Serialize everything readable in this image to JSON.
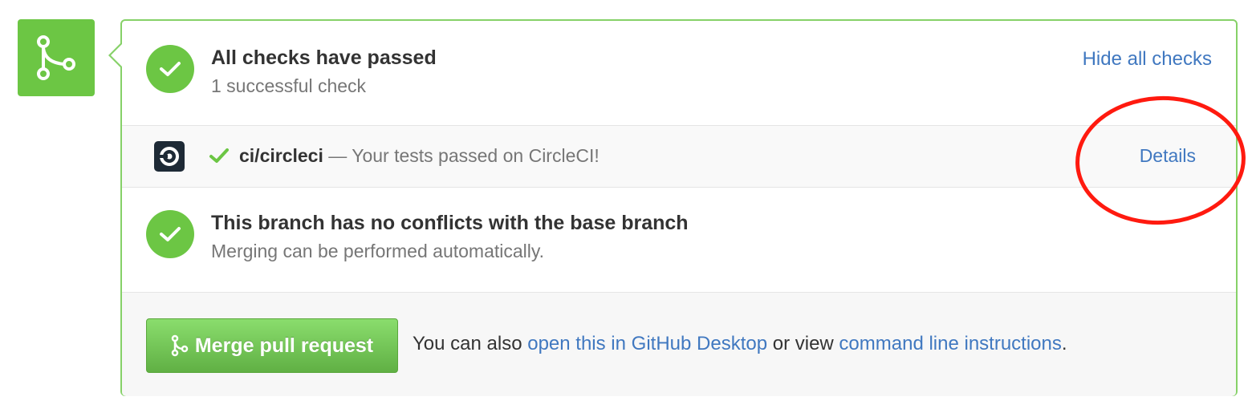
{
  "checks": {
    "title": "All checks have passed",
    "subtitle": "1 successful check",
    "toggle_label": "Hide all checks"
  },
  "ci": {
    "icon": "circleci-logo",
    "name": "ci/circleci",
    "separator": " — ",
    "description": "Your tests passed on CircleCI!",
    "details_label": "Details"
  },
  "branch": {
    "title": "This branch has no conflicts with the base branch",
    "subtitle": "Merging can be performed automatically."
  },
  "merge": {
    "button_label": "Merge pull request",
    "help_prefix": "You can also ",
    "desktop_link": "open this in GitHub Desktop",
    "help_middle": " or view ",
    "cli_link": "command line instructions",
    "help_suffix": "."
  },
  "colors": {
    "success": "#6cc644",
    "link": "#4078c0",
    "annotation": "#ff1a0f"
  }
}
